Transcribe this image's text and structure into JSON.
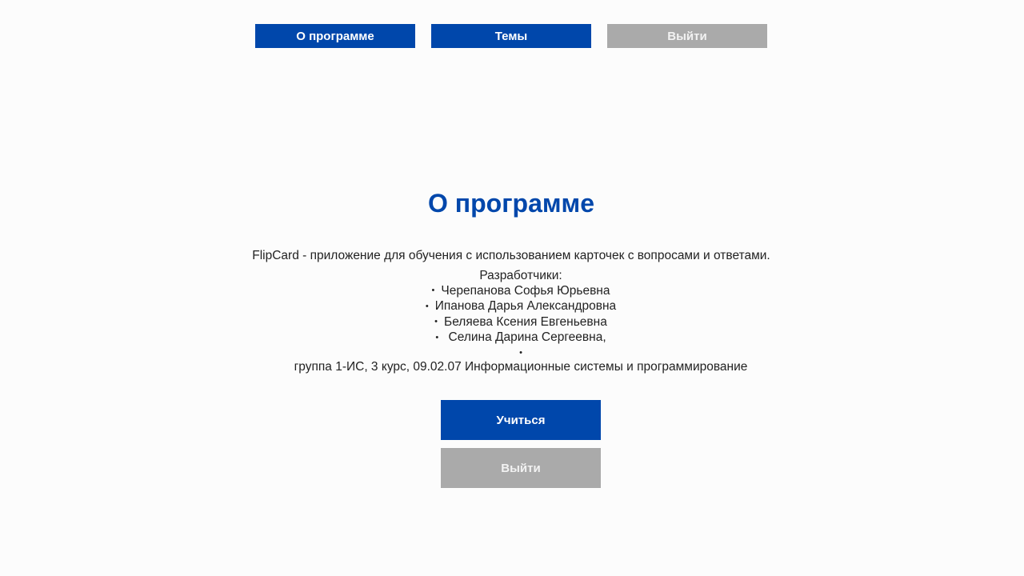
{
  "nav": {
    "about_label": "О программе",
    "topics_label": "Темы",
    "exit_label": "Выйти"
  },
  "colors": {
    "primary": "#0047ab",
    "secondary": "#aaaaaa",
    "background": "#fcfcfc"
  },
  "main": {
    "title": "О программе",
    "description": "FlipCard - приложение для обучения с использованием карточек с вопросами и ответами.",
    "developers_heading": "Разработчики:",
    "developers": [
      "Черепанова Софья Юрьевна",
      "Ипанова Дарья Александровна",
      "Беляева Ксения Евгеньевна",
      " Селина Дарина Сергеевна,",
      ""
    ],
    "group_info": "группа 1-ИС, 3 курс, 09.02.07 Информационные системы и программирование"
  },
  "actions": {
    "learn_label": "Учиться",
    "exit_label": "Выйти"
  }
}
